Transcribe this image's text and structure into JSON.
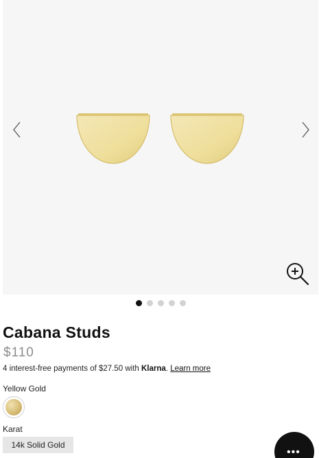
{
  "product": {
    "name": "Cabana Studs",
    "price": "$110"
  },
  "gallery": {
    "image_count": 5,
    "active_index": 0,
    "metal_color": "#f0e2a6"
  },
  "klarna": {
    "prefix": "4 interest-free payments of $27.50 with ",
    "brand": "Klarna",
    "dot": ".",
    "learn_more": "Learn more"
  },
  "options": {
    "color_label": "Yellow Gold",
    "karat_label": "Karat",
    "karat_value": "14k Solid Gold"
  },
  "icons": {
    "prev": "chevron-left-icon",
    "next": "chevron-right-icon",
    "zoom": "zoom-in-icon",
    "chat": "chat-icon"
  }
}
